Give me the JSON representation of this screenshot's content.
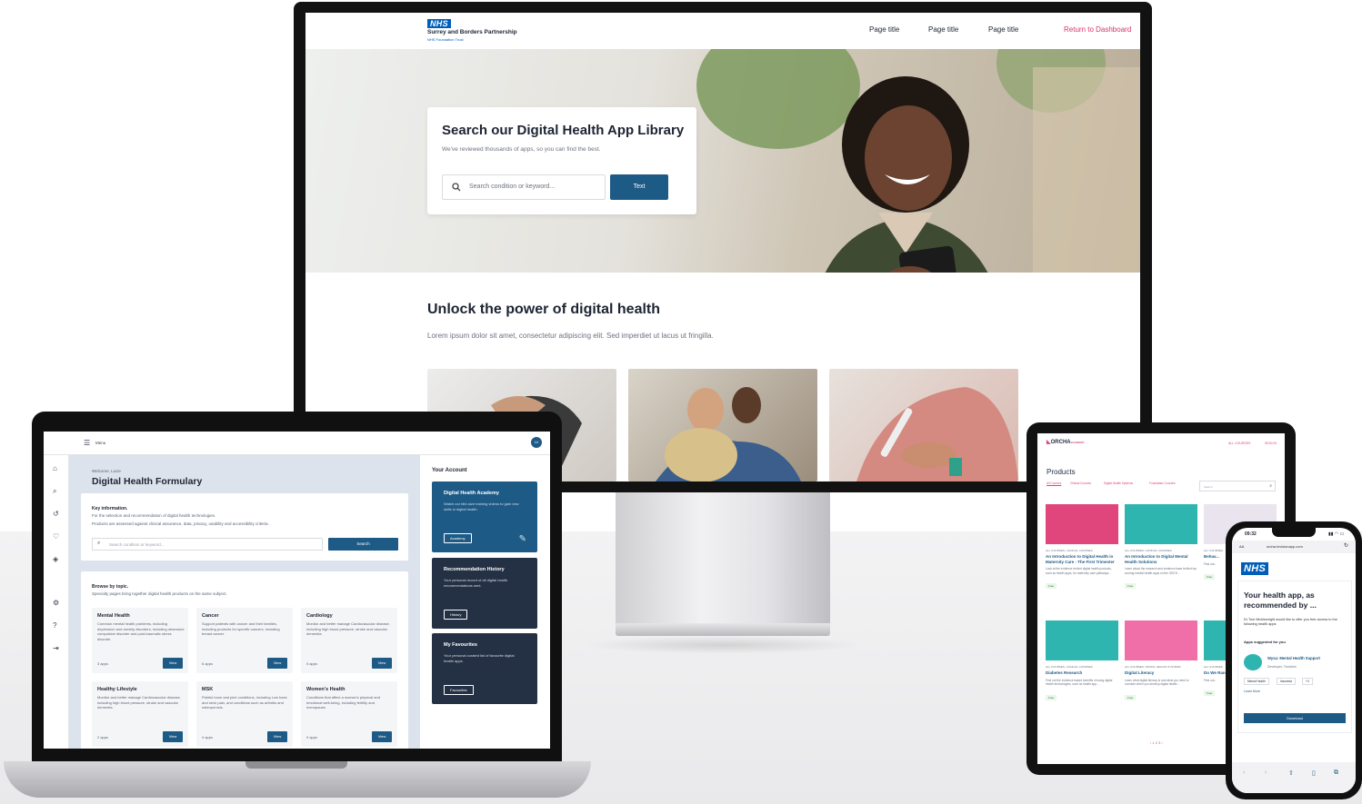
{
  "monitor": {
    "logo_badge": "NHS",
    "logo_org": "Surrey and Borders Partnership",
    "logo_trust": "NHS Foundation Trust",
    "nav": [
      "Page title",
      "Page title",
      "Page title"
    ],
    "return_link": "Return to Dashboard",
    "hero_title": "Search our Digital Health App Library",
    "hero_subtitle": "We've reviewed thousands of apps, so you can find the best.",
    "search_placeholder": "Search condition or keyword...",
    "search_button": "Text",
    "section_title": "Unlock the power of digital health",
    "section_text": "Lorem ipsum dolor sit amet, consectetur adipiscing elit. Sed imperdiet ut lacus ut fringilla."
  },
  "laptop": {
    "menu_label": "Menu",
    "avatar": "LV",
    "welcome": "Welcome, Lucie",
    "title": "Digital Health Formulary",
    "key_info_title": "Key information.",
    "key_info_line1": "For the selection and recommendation of digital health technologies.",
    "key_info_line2": "Products are assessed against clinical assurance, data, privacy, usability and accessibility criteria.",
    "search_placeholder": "Search condition or keyword...",
    "search_button": "Search",
    "browse_title": "Browse by topic.",
    "browse_text": "Specialty pages bring together digital health products on the same subject.",
    "topics": [
      {
        "name": "Mental Health",
        "desc": "Common mental health problems, including depression and anxiety disorders, including obsessive compulsive disorder and post-traumatic stress disorder.",
        "count": "3 apps",
        "button": "View"
      },
      {
        "name": "Cancer",
        "desc": "Support patients with cancer and their families, including products for specific cancers, including breast cancer.",
        "count": "6 apps",
        "button": "View"
      },
      {
        "name": "Cardiology",
        "desc": "Monitor and better manage Cardiovascular disease, including high blood pressure, stroke and vascular dementia.",
        "count": "5 apps",
        "button": "View"
      },
      {
        "name": "Healthy Lifestyle",
        "desc": "Monitor and better manage Cardiovascular disease, including high blood pressure, stroke and vascular dementia.",
        "count": "2 apps",
        "button": "View"
      },
      {
        "name": "MSK",
        "desc": "Painful bone and joint conditions, including Low back and neck pain, and conditions such as arthritis and osteoporosis.",
        "count": "4 apps",
        "button": "View"
      },
      {
        "name": "Women's Health",
        "desc": "Conditions that affect a woman's physical and emotional well-being, including fertility and menopause.",
        "count": "9 apps",
        "button": "View"
      }
    ],
    "account_title": "Your Account",
    "account_cards": [
      {
        "title": "Digital Health Academy",
        "desc": "Watch our bite-size training videos to gain new skills in digital health.",
        "button": "Academy",
        "color": "#1e5a86"
      },
      {
        "title": "Recommendation History",
        "desc": "Your personal record of all digital health recommendations sent.",
        "button": "History",
        "color": "#243044"
      },
      {
        "title": "My Favourites",
        "desc": "Your personal curated list of favourite digital health apps.",
        "button": "Favourites",
        "color": "#243044"
      }
    ]
  },
  "tablet": {
    "brand": "ORCHA",
    "brand_sub": "ACADEMY",
    "top_links": [
      "ALL COURSES",
      "SIGN IN"
    ],
    "heading": "Products",
    "filters": [
      "All Courses",
      "Clinical Courses",
      "Digital Health Systems",
      "Foundation Courses"
    ],
    "search_placeholder": "Search",
    "products": [
      {
        "cat": "ALL COURSES, CLINICAL COURSES",
        "title": "An Introduction to Digital Health in Maternity Care - The First Trimester",
        "desc": "Look at the evidence behind digital health products, such as health apps, for maternity care pathways...",
        "tag": "Free",
        "color": "#e0457b"
      },
      {
        "cat": "ALL COURSES, CLINICAL COURSES",
        "title": "An Introduction to Digital Mental Health Solutions",
        "desc": "Learn about the research and evidence base behind top scoring mental health apps on the ORCH...",
        "tag": "Free",
        "color": "#2fb5b0"
      },
      {
        "cat": "ALL COURSES",
        "title": "Behav...",
        "desc": "Find out...",
        "tag": "Free",
        "color": "#e9e4ee"
      },
      {
        "cat": "ALL COURSES, CLINICAL COURSES",
        "title": "Diabetes Research",
        "desc": "Find out the evidence based benefits of using digital health technologies, such as health app...",
        "tag": "Free",
        "color": "#2fb5b0"
      },
      {
        "cat": "ALL COURSES, DIGITAL HEALTH SYSTEMS",
        "title": "Digital Literacy",
        "desc": "Learn what digital literacy is and what you need to consider when you develop digital health...",
        "tag": "Free",
        "color": "#f06fa8"
      },
      {
        "cat": "ALL COURSES",
        "title": "Do We Random Trial?",
        "desc": "Find out...",
        "tag": "Free",
        "color": "#2fb5b0"
      }
    ],
    "pagination": "‹ 1 2 3 ›"
  },
  "phone": {
    "time": "09:32",
    "url": "orcha.invisionapp.com",
    "aa": "AA",
    "logo": "NHS",
    "heading": "Your health app, as recommended by ...",
    "intro": "Dr Tom Micklewright would like to offer you free access to the following health apps",
    "suggested": "Apps suggested for you",
    "app_name": "Wysa: Mental Health Support",
    "developer": "Developer:  Touchkin",
    "tags": [
      "Mental Health",
      "Insomnia",
      "+3"
    ],
    "learn_more": "Learn More",
    "download": "Download"
  }
}
